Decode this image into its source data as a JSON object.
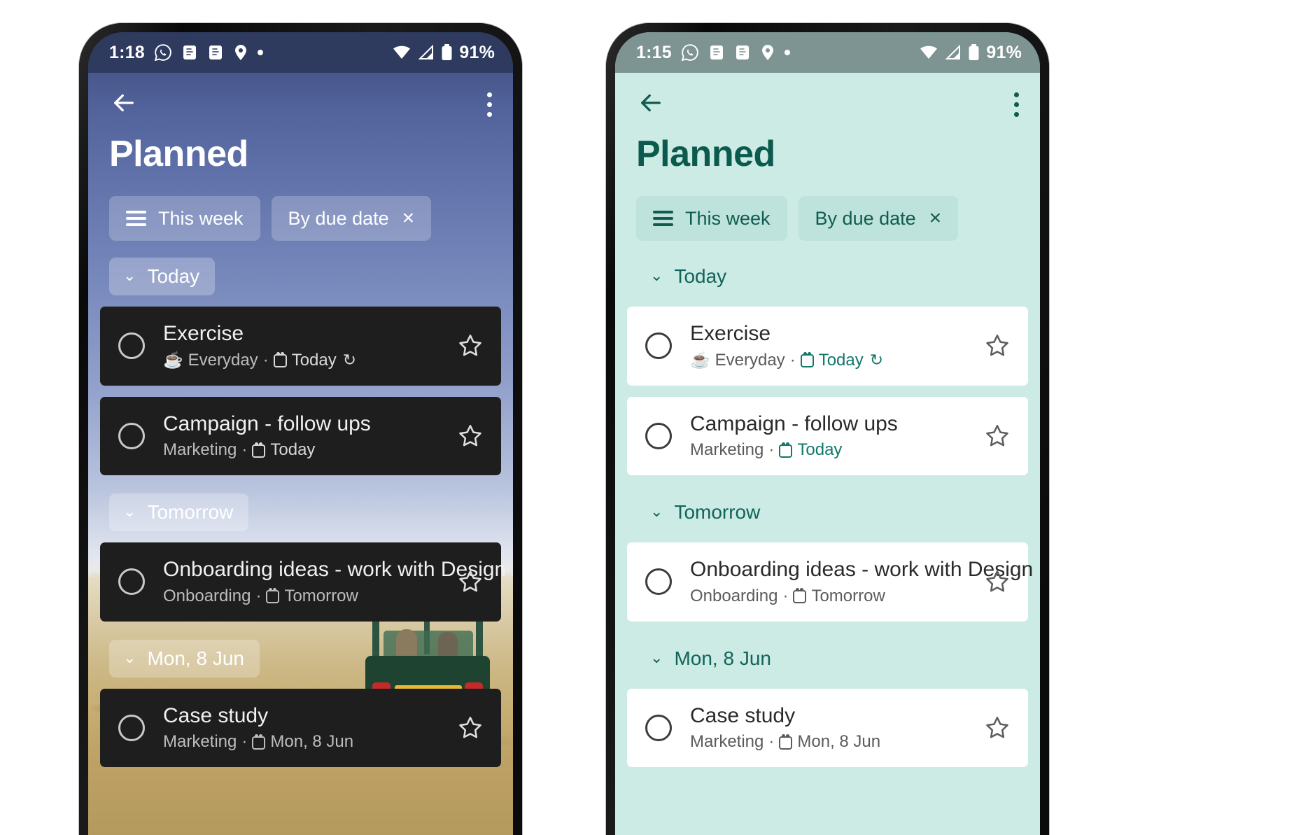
{
  "theme_colors": {
    "left_statusbar_bg": "#2e3a5e",
    "left_card_bg": "#1e1e1e",
    "right_screen_bg": "#ccebe5",
    "right_statusbar_bg": "#7d9492",
    "right_card_bg": "#ffffff",
    "right_accent": "#11786a",
    "right_title": "#0c5a4d"
  },
  "phones": [
    {
      "variant": "dark-wallpaper",
      "status_bar": {
        "time": "1:18",
        "icons_left": [
          "whatsapp-icon",
          "document-icon",
          "document-icon",
          "location-pin-icon",
          "dot-icon"
        ],
        "icons_right": [
          "wifi-icon",
          "signal-icon",
          "battery-icon"
        ],
        "battery": "91%"
      },
      "app_bar": {
        "back_icon": "back-arrow-icon",
        "overflow_icon": "kebab-menu-icon",
        "title": "Planned"
      },
      "chips": [
        {
          "icon": "hamburger-icon",
          "label": "This week",
          "trailing": ""
        },
        {
          "icon": "",
          "label": "By due date",
          "trailing": "×"
        }
      ],
      "groups": [
        {
          "label": "Today",
          "tasks": [
            {
              "title": "Exercise",
              "list_emoji": "☕",
              "list_name": "Everyday",
              "separator": "·",
              "due": "Today",
              "due_accent": true,
              "recurring": "↻",
              "star": "star-outline-icon",
              "checkbox": "checkbox-circle-icon"
            },
            {
              "title": "Campaign - follow ups",
              "list_emoji": "",
              "list_name": "Marketing",
              "separator": "·",
              "due": "Today",
              "due_accent": true,
              "recurring": "",
              "star": "star-outline-icon",
              "checkbox": "checkbox-circle-icon"
            }
          ]
        },
        {
          "label": "Tomorrow",
          "tasks": [
            {
              "title": "Onboarding ideas - work with Design",
              "list_emoji": "",
              "list_name": "Onboarding",
              "separator": "·",
              "due": "Tomorrow",
              "due_accent": false,
              "recurring": "",
              "star": "star-outline-icon",
              "checkbox": "checkbox-circle-icon"
            }
          ]
        },
        {
          "label": "Mon, 8 Jun",
          "tasks": [
            {
              "title": "Case study",
              "list_emoji": "",
              "list_name": "Marketing",
              "separator": "·",
              "due": "Mon, 8 Jun",
              "due_accent": false,
              "recurring": "",
              "star": "star-outline-icon",
              "checkbox": "checkbox-circle-icon"
            }
          ]
        }
      ]
    },
    {
      "variant": "light-teal",
      "status_bar": {
        "time": "1:15",
        "icons_left": [
          "whatsapp-icon",
          "document-icon",
          "document-icon",
          "location-pin-icon",
          "dot-icon"
        ],
        "icons_right": [
          "wifi-icon",
          "signal-icon",
          "battery-icon"
        ],
        "battery": "91%"
      },
      "app_bar": {
        "back_icon": "back-arrow-icon",
        "overflow_icon": "kebab-menu-icon",
        "title": "Planned"
      },
      "chips": [
        {
          "icon": "hamburger-icon",
          "label": "This week",
          "trailing": ""
        },
        {
          "icon": "",
          "label": "By due date",
          "trailing": "×"
        }
      ],
      "groups": [
        {
          "label": "Today",
          "tasks": [
            {
              "title": "Exercise",
              "list_emoji": "☕",
              "list_name": "Everyday",
              "separator": "·",
              "due": "Today",
              "due_accent": true,
              "recurring": "↻",
              "star": "star-outline-icon",
              "checkbox": "checkbox-circle-icon"
            },
            {
              "title": "Campaign - follow ups",
              "list_emoji": "",
              "list_name": "Marketing",
              "separator": "·",
              "due": "Today",
              "due_accent": true,
              "recurring": "",
              "star": "star-outline-icon",
              "checkbox": "checkbox-circle-icon"
            }
          ]
        },
        {
          "label": "Tomorrow",
          "tasks": [
            {
              "title": "Onboarding ideas - work with Design",
              "list_emoji": "",
              "list_name": "Onboarding",
              "separator": "·",
              "due": "Tomorrow",
              "due_accent": false,
              "recurring": "",
              "star": "star-outline-icon",
              "checkbox": "checkbox-circle-icon"
            }
          ]
        },
        {
          "label": "Mon, 8 Jun",
          "tasks": [
            {
              "title": "Case study",
              "list_emoji": "",
              "list_name": "Marketing",
              "separator": "·",
              "due": "Mon, 8 Jun",
              "due_accent": false,
              "recurring": "",
              "star": "star-outline-icon",
              "checkbox": "checkbox-circle-icon"
            }
          ]
        }
      ]
    }
  ]
}
